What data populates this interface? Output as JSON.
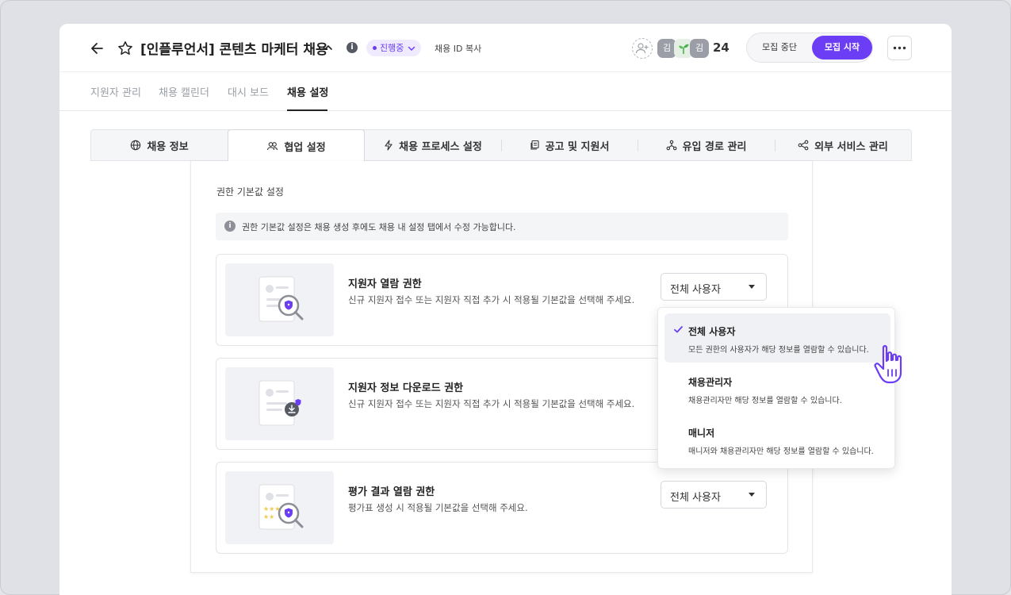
{
  "header": {
    "title": "[인플루언서] 콘텐츠 마케터 채용",
    "status_badge": "진행중",
    "copy_id_label": "채용 ID 복사",
    "avatars": [
      "김",
      "김"
    ],
    "member_count": "24",
    "stop_label": "모집 중단",
    "start_label": "모집 시작",
    "icons": [
      "arrow-left-icon",
      "star-icon",
      "chevron-up-icon",
      "info-icon",
      "add-user-icon",
      "more-icon"
    ]
  },
  "nav": {
    "tabs": [
      {
        "label": "지원자 관리"
      },
      {
        "label": "채용 캘린더"
      },
      {
        "label": "대시 보드"
      },
      {
        "label": "채용 설정",
        "active": true
      }
    ]
  },
  "subtabs": [
    {
      "label": "채용 정보",
      "icon": "globe-icon"
    },
    {
      "label": "협업 설정",
      "icon": "users-icon",
      "active": true
    },
    {
      "label": "채용 프로세스 설정",
      "icon": "bolt-icon"
    },
    {
      "label": "공고 및 지원서",
      "icon": "document-icon"
    },
    {
      "label": "유입 경로 관리",
      "icon": "network-icon"
    },
    {
      "label": "외부 서비스 관리",
      "icon": "share-icon"
    }
  ],
  "settings": {
    "section_title": "권한 기본값 설정",
    "notice": "권한 기본값 설정은 채용 생성 후에도 채용 내 설정 탭에서 수정 가능합니다.",
    "permissions": [
      {
        "title": "지원자 열람 권한",
        "description": "신규 지원자 접수 또는 지원자 직접 추가 시 적용될 기본값을 선택해 주세요.",
        "value": "전체 사용자",
        "illustration": "search-shield-document-icon"
      },
      {
        "title": "지원자 정보 다운로드 권한",
        "description": "신규 지원자 접수 또는 지원자 직접 추가 시 적용될 기본값을 선택해 주세요.",
        "value": "",
        "illustration": "download-document-icon"
      },
      {
        "title": "평가 결과 열람 권한",
        "description": "평가표 생성 시 적용될 기본값을 선택해 주세요.",
        "value": "전체 사용자",
        "illustration": "rating-document-icon"
      }
    ]
  },
  "dropdown": {
    "options": [
      {
        "label": "전체 사용자",
        "description": "모든 권한의 사용자가 해당 정보를 열람할 수 있습니다.",
        "selected": true
      },
      {
        "label": "채용관리자",
        "description": "채용관리자만 해당 정보를 열람할 수 있습니다."
      },
      {
        "label": "매니저",
        "description": "매니저와 채용관리자만 해당 정보를 열람할 수 있습니다."
      }
    ]
  },
  "colors": {
    "accent": "#6b3df5",
    "badge_bg": "#efeafe",
    "panel_bg": "#f1f2f5"
  }
}
